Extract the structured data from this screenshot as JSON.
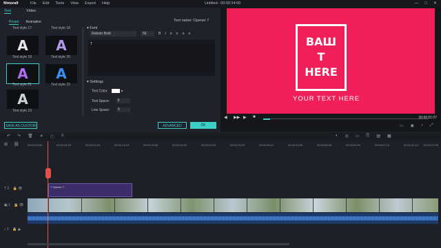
{
  "app": {
    "logo": "filmora9",
    "menu": [
      "File",
      "Edit",
      "Tools",
      "View",
      "Export",
      "Help"
    ],
    "window_title": "Untitled : 00:00:24:00"
  },
  "editor": {
    "tabs": [
      "Text",
      "Video"
    ],
    "subtabs": [
      "Preset",
      "Animation"
    ],
    "styles": [
      {
        "label": "Text style 17",
        "glyph": "A",
        "color": "#9aa7c6"
      },
      {
        "label": "Text style 18",
        "glyph": "A",
        "color": "#c48bd8"
      },
      {
        "label": "Text style 19",
        "glyph": "A",
        "color": "#e6e6f0"
      },
      {
        "label": "Text style 20",
        "glyph": "A",
        "color": "#b09ae8"
      },
      {
        "label": "Text style 21",
        "glyph": "A",
        "color": "#b06cf0"
      },
      {
        "label": "Text style 22",
        "glyph": "A",
        "color": "#3f8cf0"
      },
      {
        "label": "Text style 23",
        "glyph": "A",
        "color": "#cfd2d8"
      }
    ],
    "selected_style": "Text style 21",
    "text_name": "Text name: Opener 7",
    "font": {
      "section": "Font",
      "family": "Roboto Bold",
      "size": "56",
      "format_buttons": [
        "B",
        "I",
        "≡",
        "≡",
        "≡",
        "≡"
      ]
    },
    "text_value": "T",
    "settings": {
      "section": "Settings",
      "text_color_label": "Text Color:",
      "text_color": "#ffffff",
      "text_space_label": "Text Space:",
      "text_space": "9",
      "line_space_label": "Line Space:",
      "line_space": "0"
    },
    "buttons": {
      "save": "SAVE AS CUSTOM",
      "advanced": "ADVANCED",
      "ok": "OK"
    }
  },
  "preview": {
    "bg": "#f01f5a",
    "title_lines": [
      "ВАШ",
      "Т",
      "HERE"
    ],
    "subtitle": "YOUR TEXT HERE",
    "time": "00:00:01:07",
    "controls": [
      "◀",
      "▶▶",
      "▶",
      "■"
    ]
  },
  "timeline": {
    "toolbar_left": [
      "↶",
      "↷",
      "🗑",
      "✕",
      "ⓘ",
      "≡"
    ],
    "toolbar_right": [
      "◐",
      "◎",
      "▭",
      "⎘",
      "▤",
      "▦"
    ],
    "ruler": [
      "00:00:00:00",
      "00:00:04:20",
      "00:00:09:15",
      "00:00:14:10",
      "00:00:19:05",
      "00:00:24:00",
      "00:00:28:20",
      "00:00:33:15",
      "00:00:38:10",
      "00:00:43:05",
      "00:00:48:00",
      "00:00:52:20",
      "00:00:57:15",
      "00:01:02:10",
      "00:01:07:05"
    ],
    "text_clip": "Opener 7",
    "tracks": [
      "2",
      "1",
      "1"
    ]
  }
}
